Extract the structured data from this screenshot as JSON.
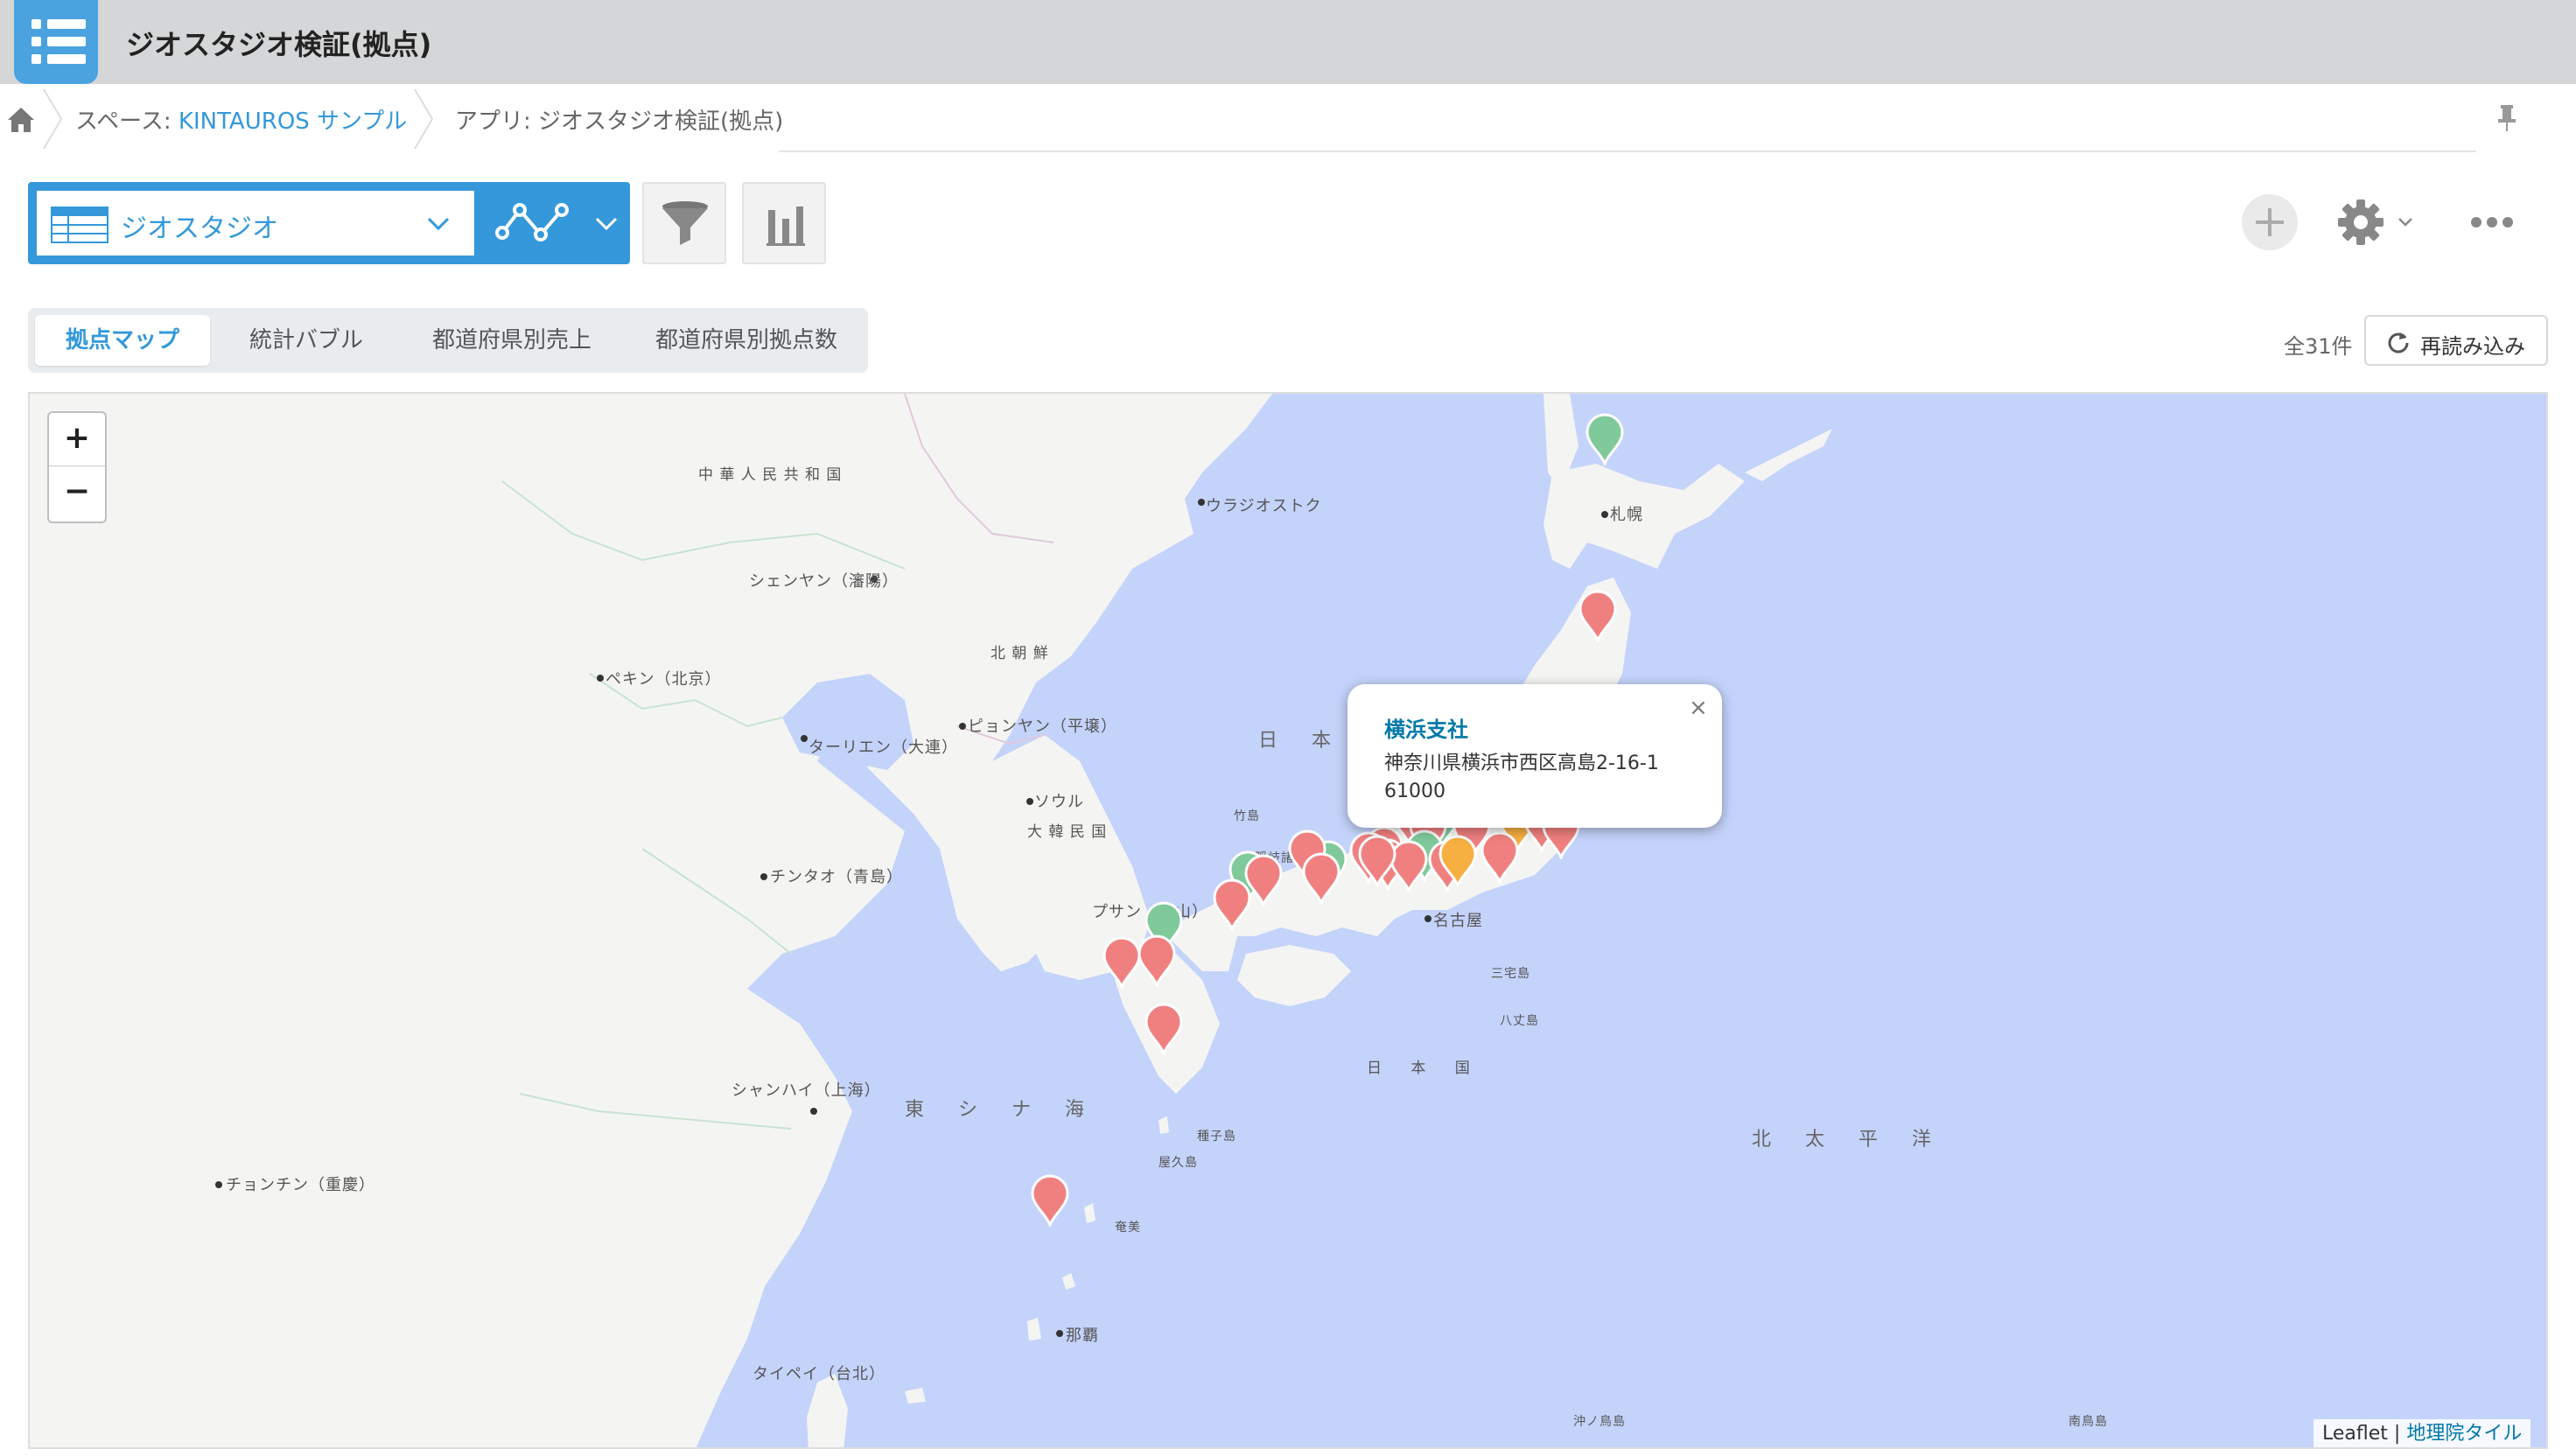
{
  "header": {
    "title": "ジオスタジオ検証(拠点)"
  },
  "breadcrumb": {
    "space_prefix": "スペース: ",
    "space_name": "KINTAUROS サンプル",
    "app_label": "アプリ: ジオスタジオ検証(拠点)"
  },
  "toolbar": {
    "view_name": "ジオスタジオ"
  },
  "tabs": [
    {
      "label": "拠点マップ",
      "active": true
    },
    {
      "label": "統計バブル",
      "active": false
    },
    {
      "label": "都道府県別売上",
      "active": false
    },
    {
      "label": "都道府県別拠点数",
      "active": false
    }
  ],
  "record_count": "全31件",
  "reload_label": "再読み込み",
  "colors": {
    "accent": "#3498db",
    "marker_red": "#f08080",
    "marker_green": "#7fc99a",
    "marker_orange": "#f5b041",
    "sea": "#c4d3fa",
    "land": "#f4f5f2"
  },
  "map": {
    "labels": {
      "china": "中 華 人 民 共 和 国",
      "vladivostok": "ウラジオストク",
      "shenyang": "シェンヤン（瀋陽）",
      "north_korea": "北 朝 鮮",
      "beijing": "ペキン（北京）",
      "dalian": "ターリエン（大連）",
      "pyongyang": "ピョンヤン（平壌）",
      "seoul": "ソウル",
      "south_korea": "大 韓 民 国",
      "qingdao": "チンタオ（青島）",
      "busan": "プサン（釜山）",
      "shanghai": "シャンハイ（上海）",
      "east_china_sea": "東 シ ナ 海",
      "chongqing": "チョンチン（重慶）",
      "taipei": "タイペイ（台北）",
      "japan_sea": "日 本",
      "japan": "日 本 国",
      "pacific": "北 太 平 洋",
      "sapporo": "札幌",
      "nagoya": "名古屋",
      "naha": "那覇",
      "takeshima": "竹島",
      "oki": "隠岐諸島",
      "tanegashima": "種子島",
      "yakushima": "屋久島",
      "amami": "奄美",
      "miyake": "三宅島",
      "hachijo": "八丈島",
      "okinotori": "沖ノ鳥島",
      "minamitori": "南鳥島"
    },
    "popup": {
      "title": "横浜支社",
      "address": "神奈川県横浜市西区高島2-16-1",
      "value": "61000",
      "close": "×"
    },
    "attribution": {
      "leaflet": "Leaflet",
      "sep": " | ",
      "tiles": "地理院タイル"
    },
    "markers": [
      {
        "color": "green"
      },
      {
        "color": "red"
      },
      {
        "color": "red"
      },
      {
        "color": "red"
      },
      {
        "color": "green"
      },
      {
        "color": "red"
      },
      {
        "color": "orange"
      },
      {
        "color": "red"
      },
      {
        "color": "red"
      },
      {
        "color": "red"
      },
      {
        "color": "red"
      },
      {
        "color": "red"
      },
      {
        "color": "red"
      },
      {
        "color": "green"
      },
      {
        "color": "red"
      },
      {
        "color": "red"
      },
      {
        "color": "red"
      },
      {
        "color": "green"
      },
      {
        "color": "red"
      },
      {
        "color": "red"
      },
      {
        "color": "red"
      },
      {
        "color": "red"
      },
      {
        "color": "green"
      },
      {
        "color": "red"
      },
      {
        "color": "orange"
      },
      {
        "color": "red"
      },
      {
        "color": "green"
      },
      {
        "color": "red"
      },
      {
        "color": "red"
      },
      {
        "color": "red"
      },
      {
        "color": "red"
      }
    ]
  }
}
